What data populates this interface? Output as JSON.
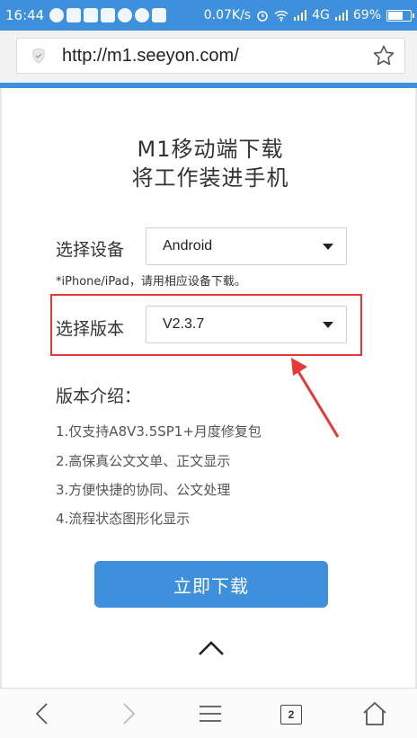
{
  "status_bar": {
    "time": "16:44",
    "network_speed": "0.07K/s",
    "network_type": "4G",
    "battery": "69%",
    "battery_level": 0.69,
    "background_color": "#3e8fdc"
  },
  "browser": {
    "url": "http://m1.seeyon.com/",
    "tab_count": "2"
  },
  "page": {
    "title_line1": "M1移动端下载",
    "title_line2": "将工作装进手机",
    "device": {
      "label": "选择设备",
      "selected": "Android"
    },
    "device_hint": "*iPhone/iPad，请用相应设备下载。",
    "version": {
      "label": "选择版本",
      "selected": "V2.3.7"
    },
    "intro": {
      "title": "版本介绍：",
      "items": [
        "1.仅支持A8V3.5SP1+月度修复包",
        "2.高保真公文文单、正文显示",
        "3.方便快捷的协同、公文处理",
        "4.流程状态图形化显示"
      ]
    },
    "download_button": "立即下载",
    "accent_color": "#3e8fdc",
    "highlight_color": "#e53935"
  },
  "icons": {
    "shield": "shield-icon",
    "star": "star-icon",
    "caret": "caret-down-icon",
    "scroll_top": "chevron-up-icon",
    "back": "back-icon",
    "forward": "forward-icon",
    "menu": "menu-icon",
    "tabs": "tabs-icon",
    "home": "home-icon"
  }
}
